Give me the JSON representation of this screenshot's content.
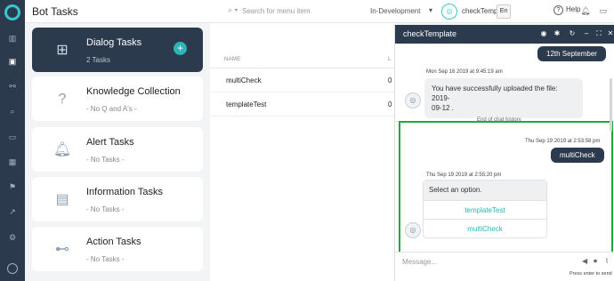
{
  "app": {
    "title": "Bot Tasks"
  },
  "header": {
    "search_placeholder": "Search for menu item",
    "environment": "In-Development",
    "bot_name": "checkTemplate",
    "language": "En",
    "help_label": "Help"
  },
  "tasks": [
    {
      "name": "Dialog Tasks",
      "count": "2 Tasks"
    },
    {
      "name": "Knowledge Collection",
      "count": "- No Q and A's -"
    },
    {
      "name": "Alert Tasks",
      "count": "- No Tasks -"
    },
    {
      "name": "Information Tasks",
      "count": "- No Tasks -"
    },
    {
      "name": "Action Tasks",
      "count": "- No Tasks -"
    }
  ],
  "task_list": {
    "col_name": "NAME",
    "col_second": "L",
    "rows": [
      {
        "name": "multiCheck",
        "value": "0"
      },
      {
        "name": "templateTest",
        "value": "0"
      }
    ]
  },
  "chat": {
    "title": "checkTemplate",
    "prev_user_message": "12th September",
    "upload_time": "Mon Sep 16 2019 at 9:45:19 am",
    "upload_message_1": "You have successfully uploaded the file: 2019-",
    "upload_message_2": "09-12 .",
    "end_of_history": "End of chat history",
    "user_time": "Thu Sep 19 2019 at 2:53:58 pm",
    "user_message": "multiCheck",
    "bot_time": "Thu Sep 19 2019 at 2:55:20 pm",
    "bot_prompt": "Select an option.",
    "options": [
      "templateTest",
      "multiCheck"
    ],
    "input_placeholder": "Message...",
    "send_hint": "Press enter to send"
  },
  "colors": {
    "accent": "#2bb5b8",
    "dark": "#2c3a4d",
    "highlight": "#1aaa3a"
  }
}
